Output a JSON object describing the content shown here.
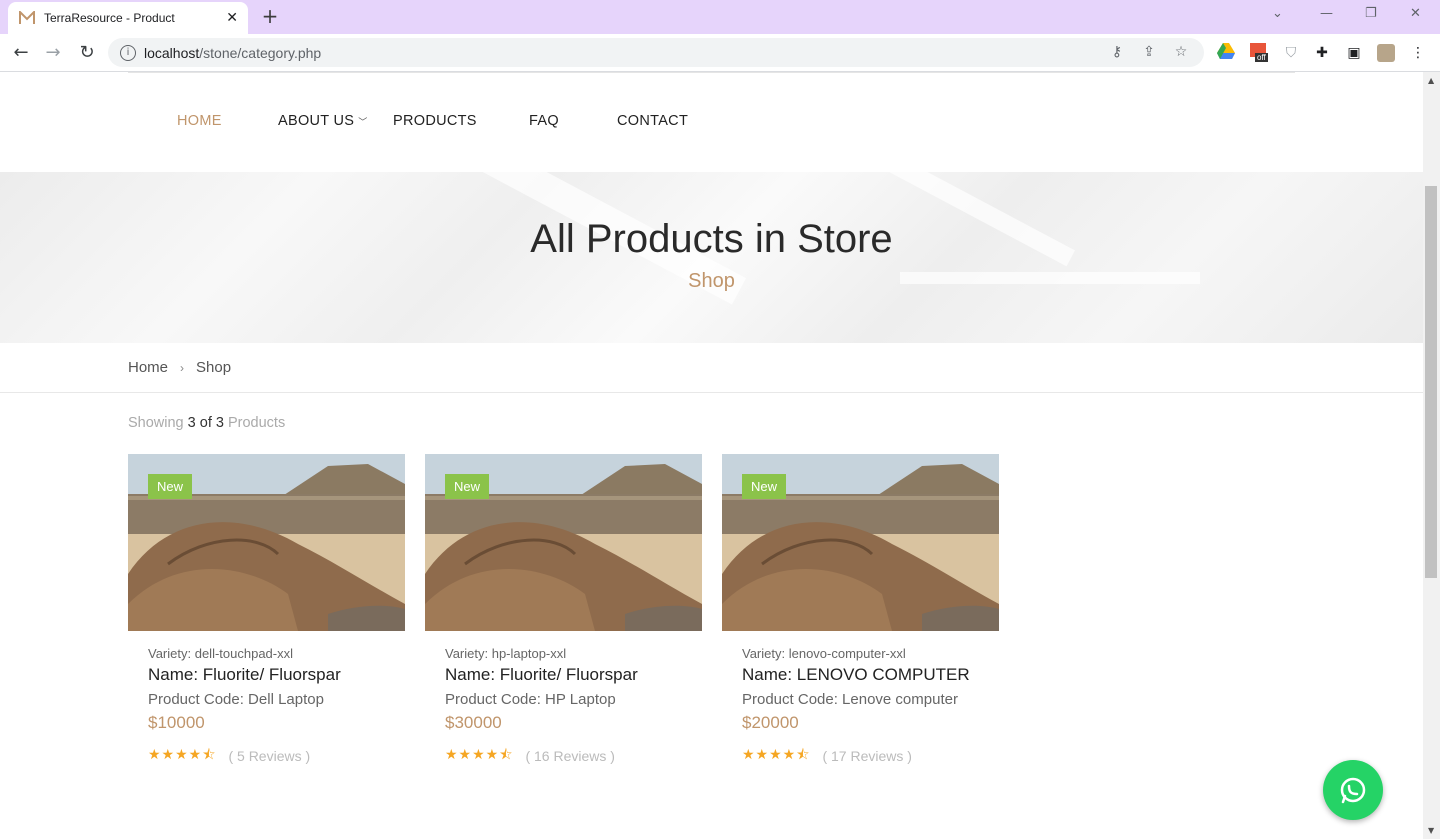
{
  "browser": {
    "tab_title": "TerraResource - Product",
    "url_host": "localhost",
    "url_path": "/stone/category.php",
    "ext_badge": "off"
  },
  "nav": {
    "items": [
      {
        "label": "HOME",
        "active": true
      },
      {
        "label": "ABOUT US",
        "active": false
      },
      {
        "label": "PRODUCTS",
        "active": false
      },
      {
        "label": "FAQ",
        "active": false
      },
      {
        "label": "CONTACT",
        "active": false
      }
    ]
  },
  "banner": {
    "title": "All Products in Store",
    "subtitle": "Shop"
  },
  "breadcrumb": {
    "items": [
      "Home",
      "Shop"
    ]
  },
  "showing": {
    "prefix": "Showing",
    "count": "3 of 3",
    "suffix": "Products"
  },
  "products": [
    {
      "badge": "New",
      "variety": "Variety: dell-touchpad-xxl",
      "name": "Name: Fluorite/ Fluorspar",
      "code": "Product Code: Dell Laptop",
      "price": "$10000",
      "rating": 4.5,
      "reviews": "( 5 Reviews )"
    },
    {
      "badge": "New",
      "variety": "Variety: hp-laptop-xxl",
      "name": "Name: Fluorite/ Fluorspar",
      "code": "Product Code: HP Laptop",
      "price": "$30000",
      "rating": 4.5,
      "reviews": "( 16 Reviews )"
    },
    {
      "badge": "New",
      "variety": "Variety: lenovo-computer-xxl",
      "name": "Name: LENOVO COMPUTER",
      "code": "Product Code: Lenove computer",
      "price": "$20000",
      "rating": 4.5,
      "reviews": "( 17 Reviews )"
    }
  ],
  "colors": {
    "accent": "#c0956b",
    "badge": "#8bc34a",
    "star": "#f5a623",
    "whatsapp": "#25d366"
  },
  "icons": {
    "whatsapp": "whatsapp-icon"
  }
}
